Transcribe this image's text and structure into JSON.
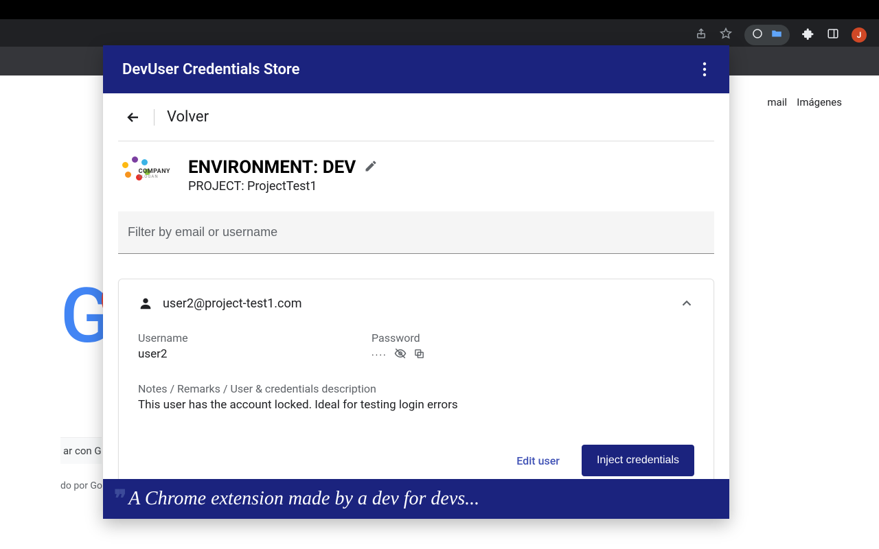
{
  "chrome": {
    "avatar_letter": "J"
  },
  "background": {
    "mail_link": "mail",
    "images_link": "Imágenes",
    "search_btn_fragment": "ar con G",
    "offered_fragment": "do por Go"
  },
  "popup": {
    "title": "DevUser Credentials Store",
    "back_label": "Volver",
    "logo_text": "COMPANY",
    "logo_sub": "SLOGAN",
    "env_title": "ENVIRONMENT: DEV",
    "project_line": "PROJECT: ProjectTest1",
    "filter_placeholder": "Filter by email or username",
    "footer_text": "A Chrome extension made by a dev for devs..."
  },
  "card": {
    "email": "user2@project-test1.com",
    "username_label": "Username",
    "username_value": "user2",
    "password_label": "Password",
    "password_masked": "····",
    "notes_label": "Notes / Remarks / User & credentials description",
    "notes_value": "This user has the account locked. Ideal for testing login errors",
    "edit_btn": "Edit user",
    "inject_btn": "Inject credentials"
  }
}
